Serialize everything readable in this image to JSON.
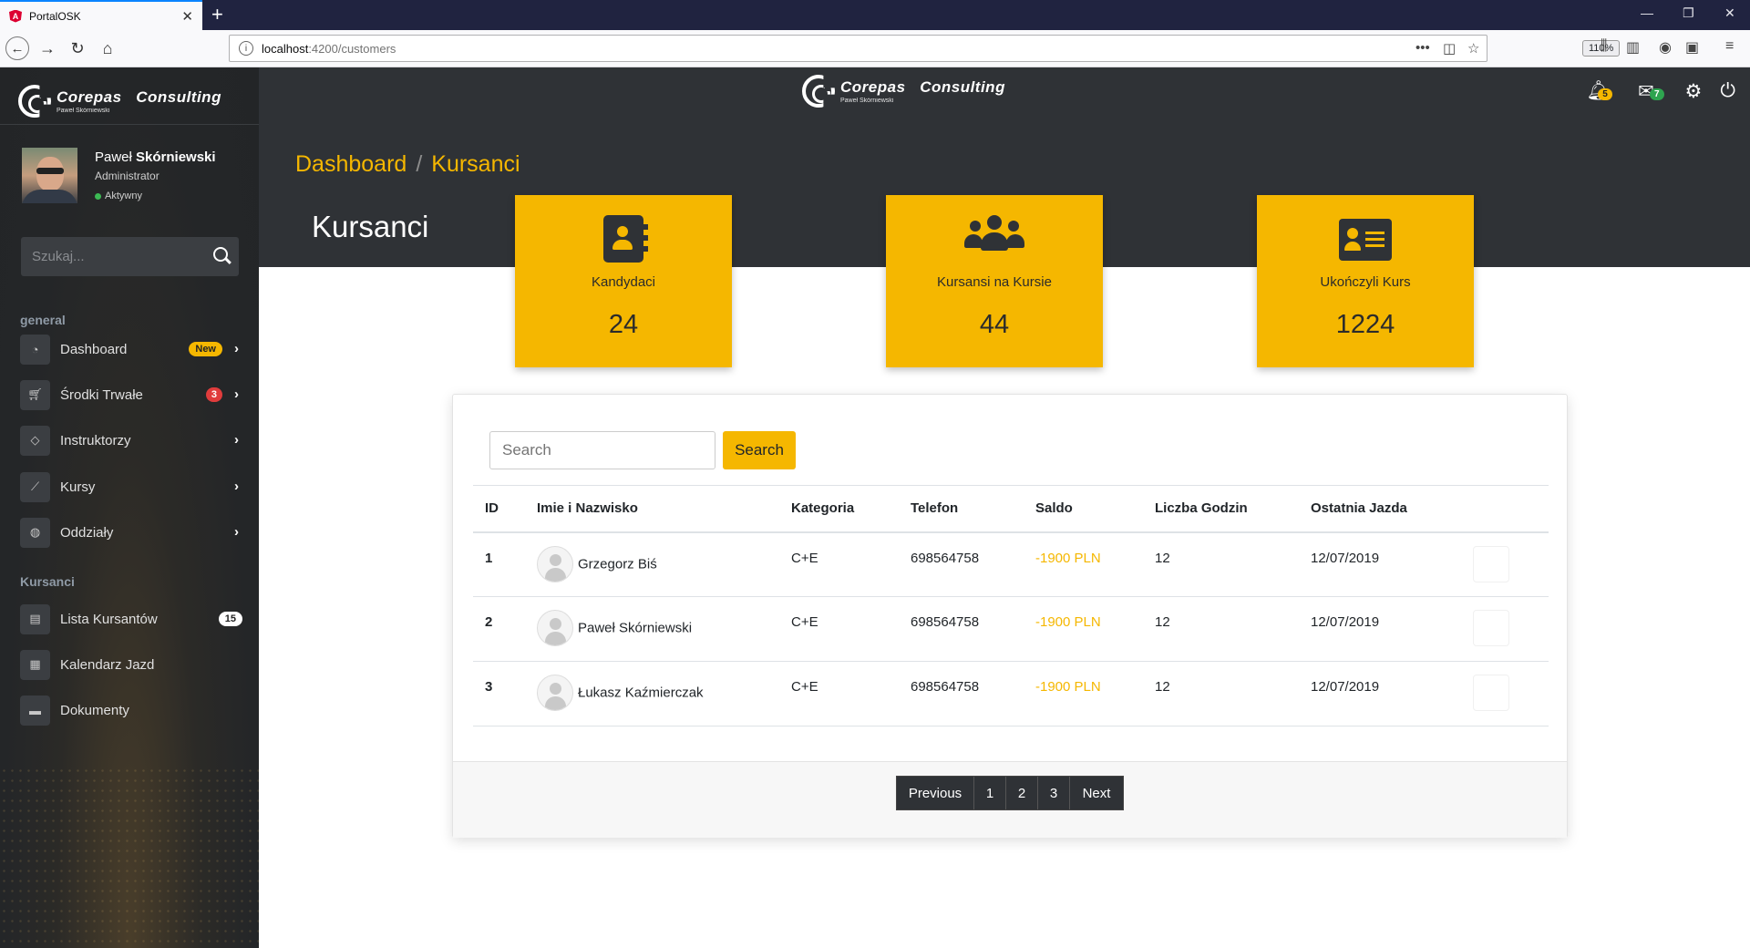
{
  "browser": {
    "tab_title": "PortalOSK",
    "favicon_letter": "A",
    "url_host": "localhost",
    "url_path": ":4200/customers",
    "zoom": "110%"
  },
  "brand": {
    "name": "Corepas   Consulting",
    "subtitle": "Paweł Skórniewski"
  },
  "user": {
    "first_name": "Paweł ",
    "last_name": "Skórniewski",
    "role": "Administrator",
    "status": "Aktywny"
  },
  "sidebar": {
    "search_placeholder": "Szukaj...",
    "sections": [
      {
        "title": "general",
        "items": [
          {
            "label": "Dashboard",
            "icon": "tachometer-icon",
            "badge": "New"
          },
          {
            "label": "Środki Trwałe",
            "icon": "cart-icon",
            "badge": "3"
          },
          {
            "label": "Instruktorzy",
            "icon": "gem-icon",
            "badge": ""
          },
          {
            "label": "Kursy",
            "icon": "chart-line-icon",
            "badge": ""
          },
          {
            "label": "Oddziały",
            "icon": "globe-icon",
            "badge": ""
          }
        ]
      },
      {
        "title": "Kursanci",
        "items": [
          {
            "label": "Lista Kursantów",
            "icon": "book-icon",
            "badge": "15"
          },
          {
            "label": "Kalendarz Jazd",
            "icon": "calendar-icon",
            "badge": ""
          },
          {
            "label": "Dokumenty",
            "icon": "folder-icon",
            "badge": ""
          }
        ]
      }
    ]
  },
  "topbar": {
    "notifications": "5",
    "messages": "7"
  },
  "breadcrumb": {
    "home": "Dashboard",
    "separator": "/",
    "current": "Kursanci"
  },
  "page_title": "Kursanci",
  "stats": [
    {
      "label": "Kandydaci",
      "value": "24",
      "icon": "address-book-icon"
    },
    {
      "label": "Kursansi na Kursie",
      "value": "44",
      "icon": "users-icon"
    },
    {
      "label": "Ukończyli Kurs",
      "value": "1224",
      "icon": "id-card-icon"
    }
  ],
  "table": {
    "search_placeholder": "Search",
    "search_button": "Search",
    "columns": [
      "ID",
      "Imie i Nazwisko",
      "Kategoria",
      "Telefon",
      "Saldo",
      "Liczba Godzin",
      "Ostatnia Jazda"
    ],
    "rows": [
      {
        "id": "1",
        "name": "Grzegorz Biś",
        "category": "C+E",
        "phone": "698564758",
        "saldo": "-1900 PLN",
        "hours": "12",
        "last": "12/07/2019"
      },
      {
        "id": "2",
        "name": "Paweł Skórniewski",
        "category": "C+E",
        "phone": "698564758",
        "saldo": "-1900 PLN",
        "hours": "12",
        "last": "12/07/2019"
      },
      {
        "id": "3",
        "name": "Łukasz Kaźmierczak",
        "category": "C+E",
        "phone": "698564758",
        "saldo": "-1900 PLN",
        "hours": "12",
        "last": "12/07/2019"
      }
    ]
  },
  "pagination": {
    "previous": "Previous",
    "pages": [
      "1",
      "2",
      "3"
    ],
    "next": "Next"
  },
  "colors": {
    "accent": "#f5b700",
    "dark": "#2f3236",
    "sidebar": "#242628"
  }
}
